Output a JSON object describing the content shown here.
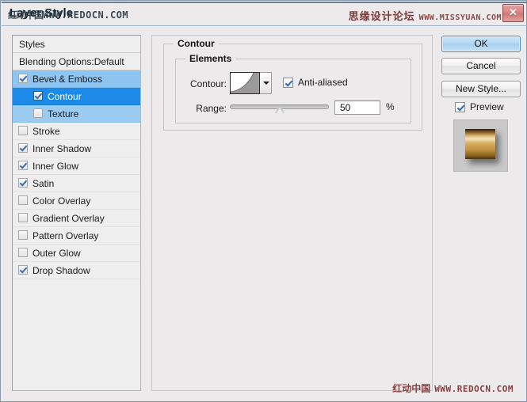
{
  "window": {
    "title": "Layer Style",
    "close_label": "✕"
  },
  "watermarks": {
    "title_left_cn": "红动中国",
    "title_left_en": "WWW.REDOCN.COM",
    "title_right_cn": "思缘设计论坛",
    "title_right_en": "WWW.MISSYUAN.COM",
    "bottom_cn": "红动中国",
    "bottom_en": "WWW.REDOCN.COM"
  },
  "styles_panel": {
    "header": "Styles",
    "blending_options": "Blending Options:Default",
    "items": [
      {
        "label": "Bevel & Emboss",
        "checked": true,
        "indent": false,
        "state": "parent-selected"
      },
      {
        "label": "Contour",
        "checked": true,
        "indent": true,
        "state": "sub-selected"
      },
      {
        "label": "Texture",
        "checked": false,
        "indent": true,
        "state": "sub"
      },
      {
        "label": "Stroke",
        "checked": false,
        "indent": false,
        "state": "normal"
      },
      {
        "label": "Inner Shadow",
        "checked": true,
        "indent": false,
        "state": "normal"
      },
      {
        "label": "Inner Glow",
        "checked": true,
        "indent": false,
        "state": "normal"
      },
      {
        "label": "Satin",
        "checked": true,
        "indent": false,
        "state": "normal"
      },
      {
        "label": "Color Overlay",
        "checked": false,
        "indent": false,
        "state": "normal"
      },
      {
        "label": "Gradient Overlay",
        "checked": false,
        "indent": false,
        "state": "normal"
      },
      {
        "label": "Pattern Overlay",
        "checked": false,
        "indent": false,
        "state": "normal"
      },
      {
        "label": "Outer Glow",
        "checked": false,
        "indent": false,
        "state": "normal"
      },
      {
        "label": "Drop Shadow",
        "checked": true,
        "indent": false,
        "state": "normal"
      }
    ]
  },
  "contour_panel": {
    "group_title": "Contour",
    "elements_title": "Elements",
    "contour_label": "Contour:",
    "contour_preset": "cone-inverted-curve",
    "anti_aliased_label": "Anti-aliased",
    "anti_aliased_checked": true,
    "range_label": "Range:",
    "range_value": "50",
    "range_unit": "%",
    "range_percent": 50
  },
  "buttons": {
    "ok": "OK",
    "cancel": "Cancel",
    "new_style": "New Style...",
    "preview_label": "Preview",
    "preview_checked": true
  },
  "colors": {
    "titlebar_blue": "#aec5e2",
    "selection_blue": "#1e8ae8",
    "parent_selection_blue": "#8ec5f0",
    "default_button_blue": "#b4d7f2",
    "close_button_red": "#d98585",
    "panel_bg": "#eceaea",
    "preview_gold": "#d9ae5e"
  }
}
